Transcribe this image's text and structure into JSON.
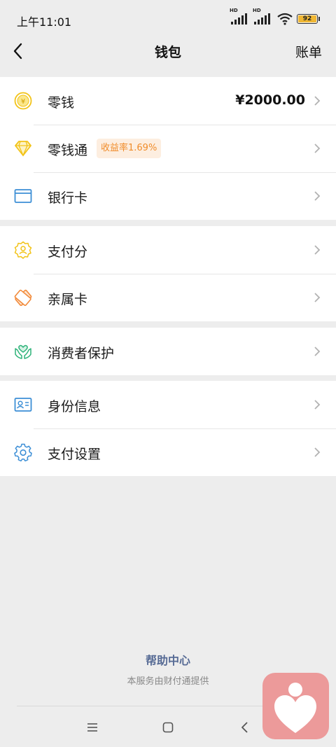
{
  "status_bar": {
    "time": "上午11:01",
    "signal_label_1": "HD",
    "signal_label_2": "HD",
    "battery_level": "92",
    "battery_fraction": 0.92
  },
  "nav": {
    "back_icon": "chevron-left-icon",
    "title": "钱包",
    "right_action": "账单"
  },
  "groups": [
    {
      "items": [
        {
          "icon": "coin-yuan-icon",
          "label": "零钱",
          "value": "¥2000.00",
          "color": "#f2c318"
        },
        {
          "icon": "diamond-icon",
          "label": "零钱通",
          "badge": "收益率1.69%",
          "color": "#f2c318"
        },
        {
          "icon": "bank-card-icon",
          "label": "银行卡",
          "color": "#3d8fd6"
        }
      ]
    },
    {
      "items": [
        {
          "icon": "credit-score-icon",
          "label": "支付分",
          "color": "#f2c318"
        },
        {
          "icon": "family-card-icon",
          "label": "亲属卡",
          "color": "#f28a3a"
        }
      ]
    },
    {
      "items": [
        {
          "icon": "protect-hands-icon",
          "label": "消费者保护",
          "color": "#2fb37a"
        }
      ]
    },
    {
      "items": [
        {
          "icon": "id-card-icon",
          "label": "身份信息",
          "color": "#3d8fd6"
        },
        {
          "icon": "settings-gear-icon",
          "label": "支付设置",
          "color": "#3d8fd6"
        }
      ]
    }
  ],
  "footer": {
    "help_link": "帮助中心",
    "provider_note": "本服务由财付通提供"
  },
  "system_nav": {
    "menu_icon": "menu-icon",
    "home_icon": "home-square-icon",
    "back_icon": "back-triangle-icon"
  },
  "floating_app": {
    "icon": "heart-person-icon",
    "color": "#ec9a9a"
  },
  "colors": {
    "background": "#ededed",
    "card": "#ffffff",
    "link": "#576b95",
    "badge_text": "#f08c2a",
    "badge_bg": "#fdeee0"
  }
}
